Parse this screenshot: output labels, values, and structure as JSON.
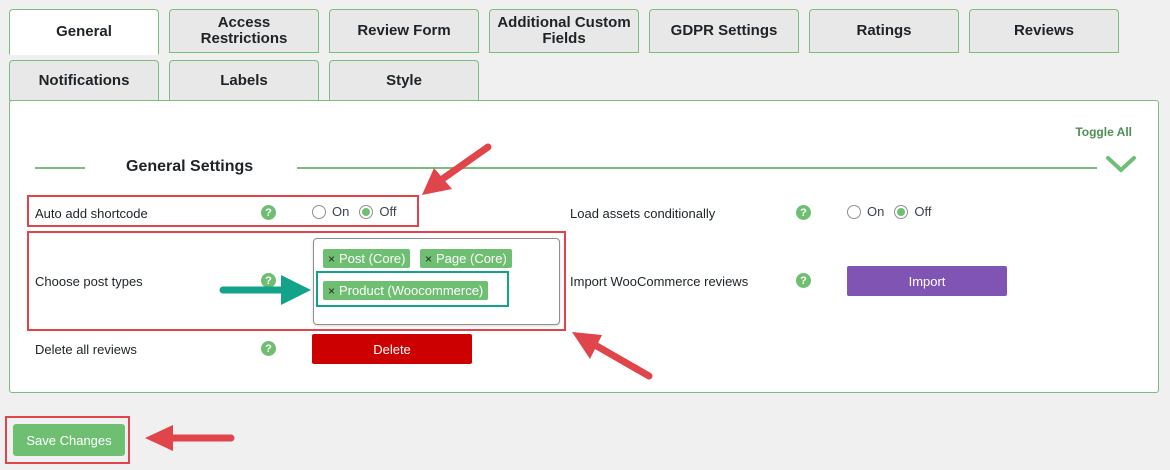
{
  "tabs": [
    {
      "label": "General",
      "active": true
    },
    {
      "label": "Access Restrictions"
    },
    {
      "label": "Review Form"
    },
    {
      "label": "Additional Custom Fields"
    },
    {
      "label": "GDPR Settings"
    },
    {
      "label": "Ratings"
    },
    {
      "label": "Reviews"
    },
    {
      "label": "Notifications"
    },
    {
      "label": "Labels"
    },
    {
      "label": "Style"
    }
  ],
  "panel": {
    "toggle_all": "Toggle All",
    "section_title": "General Settings"
  },
  "settings": {
    "auto_add_shortcode": {
      "label": "Auto add shortcode",
      "on": "On",
      "off": "Off",
      "selected": "Off"
    },
    "load_assets": {
      "label": "Load assets conditionally",
      "on": "On",
      "off": "Off",
      "selected": "Off"
    },
    "post_types": {
      "label": "Choose post types",
      "chips": [
        "Post (Core)",
        "Page (Core)",
        "Product (Woocommerce)"
      ],
      "remove_glyph": "×"
    },
    "import_woo": {
      "label": "Import WooCommerce reviews",
      "button": "Import"
    },
    "delete_reviews": {
      "label": "Delete all reviews",
      "button": "Delete"
    }
  },
  "help_glyph": "?",
  "save_button": "Save Changes",
  "colors": {
    "accent_green": "#6fbf73",
    "border_green": "#7cbc7c",
    "import_purple": "#7f54b3",
    "delete_red": "#cc0000",
    "annotation_red": "#e0454b",
    "annotation_teal": "#12a38a"
  }
}
